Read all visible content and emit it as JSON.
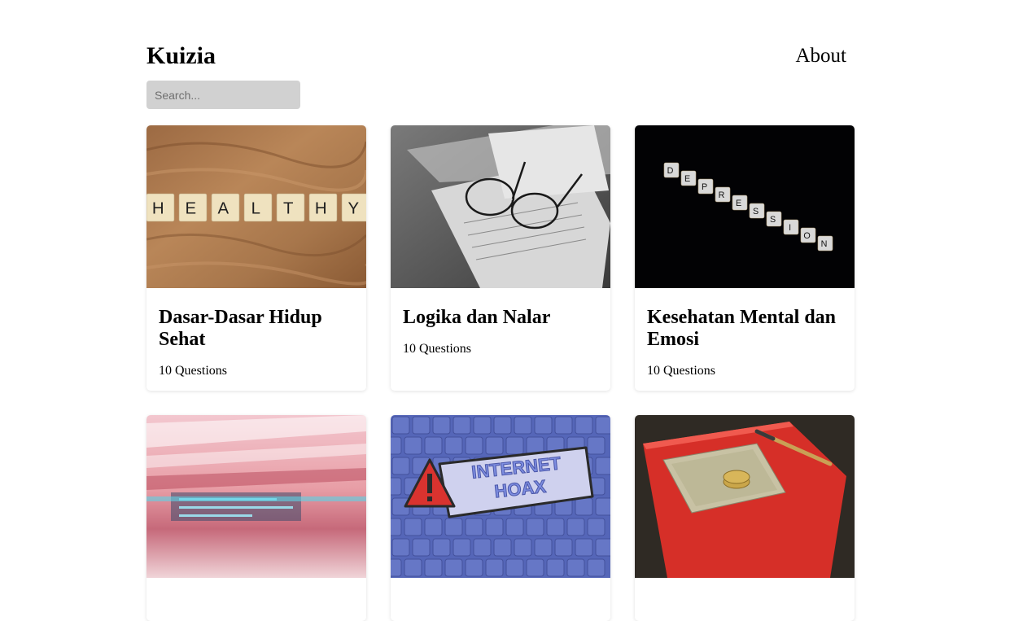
{
  "header": {
    "brand": "Kuizia",
    "about_label": "About"
  },
  "search": {
    "placeholder": "Search..."
  },
  "cards": [
    {
      "title": "Dasar-Dasar Hidup Sehat",
      "meta": "10 Questions",
      "image": "healthy-tiles-photo"
    },
    {
      "title": "Logika dan Nalar",
      "meta": "10 Questions",
      "image": "glasses-on-paper-photo"
    },
    {
      "title": "Kesehatan Mental dan Emosi",
      "meta": "10 Questions",
      "image": "depression-tiles-photo"
    },
    {
      "title": "",
      "meta": "",
      "image": "light-streaks-photo"
    },
    {
      "title": "",
      "meta": "",
      "image": "internet-hoax-photo",
      "image_text": [
        "INTERNET",
        "HOAX"
      ]
    },
    {
      "title": "",
      "meta": "",
      "image": "money-on-notebook-photo"
    }
  ],
  "tile_words": {
    "healthy": [
      "H",
      "E",
      "A",
      "L",
      "T",
      "H",
      "Y"
    ],
    "depression": [
      "D",
      "E",
      "P",
      "R",
      "E",
      "S",
      "S",
      "I",
      "O",
      "N"
    ]
  }
}
